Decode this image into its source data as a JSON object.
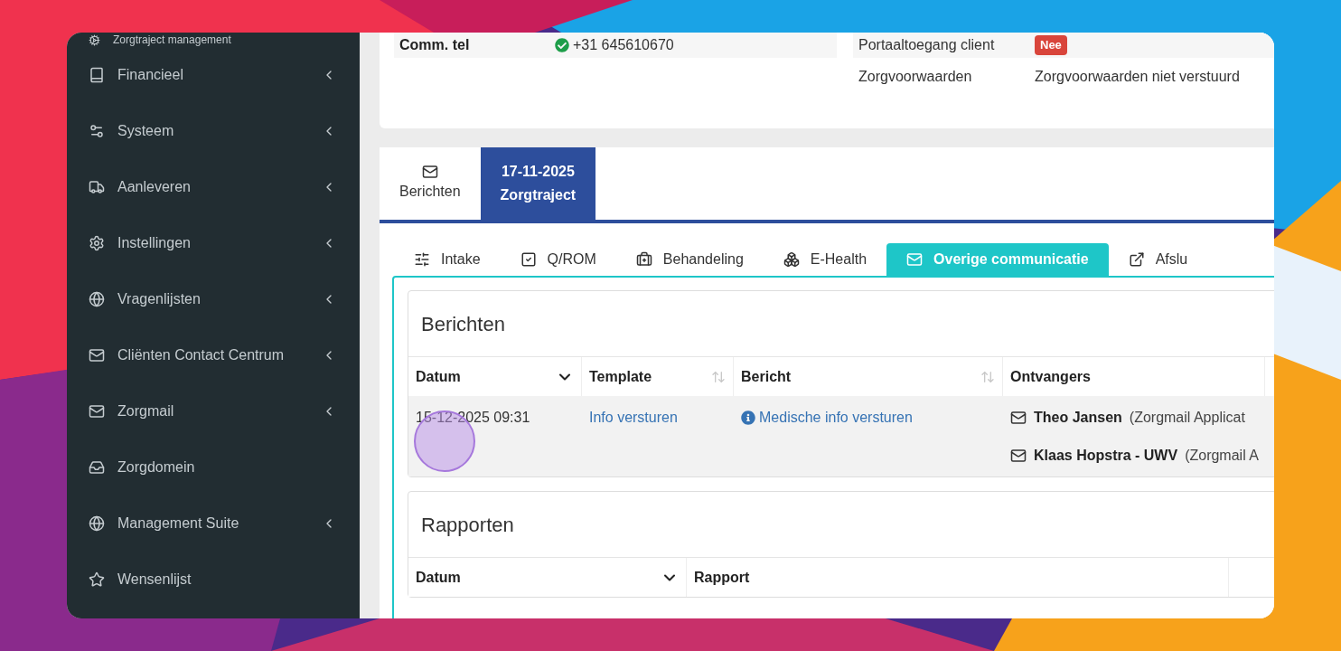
{
  "sidebar": {
    "items": [
      {
        "label": "Zorgtraject management",
        "has_submenu": false
      },
      {
        "label": "Financieel",
        "has_submenu": true
      },
      {
        "label": "Systeem",
        "has_submenu": true
      },
      {
        "label": "Aanleveren",
        "has_submenu": true
      },
      {
        "label": "Instellingen",
        "has_submenu": true
      },
      {
        "label": "Vragenlijsten",
        "has_submenu": true
      },
      {
        "label": "Cliënten Contact Centrum",
        "has_submenu": true
      },
      {
        "label": "Zorgmail",
        "has_submenu": true
      },
      {
        "label": "Zorgdomein",
        "has_submenu": false
      },
      {
        "label": "Management Suite",
        "has_submenu": true
      },
      {
        "label": "Wensenlijst",
        "has_submenu": false
      }
    ]
  },
  "client_info": {
    "left": [
      {
        "label": "Comm. tel",
        "value": "+31 645610670",
        "verified": true
      }
    ],
    "right": [
      {
        "label": "Portaaltoegang client",
        "badge": "Nee"
      },
      {
        "label": "Zorgvoorwaarden",
        "value": "Zorgvoorwaarden niet verstuurd"
      }
    ]
  },
  "main_tabs": [
    {
      "label": "Berichten",
      "selected": false,
      "kind": "icon"
    },
    {
      "label": "17-11-2025",
      "sublabel": "Zorgtraject",
      "selected": true,
      "kind": "date"
    }
  ],
  "sub_tabs": [
    {
      "label": "Intake",
      "selected": false
    },
    {
      "label": "Q/ROM",
      "selected": false
    },
    {
      "label": "Behandeling",
      "selected": false
    },
    {
      "label": "E-Health",
      "selected": false
    },
    {
      "label": "Overige communicatie",
      "selected": true
    },
    {
      "label": "Afslu",
      "selected": false
    }
  ],
  "berichten": {
    "title": "Berichten",
    "columns": [
      {
        "label": "Datum",
        "sortable": true,
        "sorted": true
      },
      {
        "label": "Template",
        "sortable": true,
        "sorted": false
      },
      {
        "label": "Bericht",
        "sortable": true,
        "sorted": false
      },
      {
        "label": "Ontvangers",
        "sortable": false,
        "sorted": false
      }
    ],
    "rows": [
      {
        "datum": "15-12-2025 09:31",
        "template": "Info versturen",
        "bericht": "Medische info versturen",
        "ontvangers": [
          {
            "name": "Theo Jansen",
            "detail": "(Zorgmail Applicat"
          },
          {
            "name": "Klaas Hopstra - UWV",
            "detail": "(Zorgmail A"
          }
        ]
      }
    ]
  },
  "rapporten": {
    "title": "Rapporten",
    "columns": [
      {
        "label": "Datum",
        "sortable": true,
        "sorted": true
      },
      {
        "label": "Rapport",
        "sortable": false,
        "sorted": false
      }
    ]
  }
}
